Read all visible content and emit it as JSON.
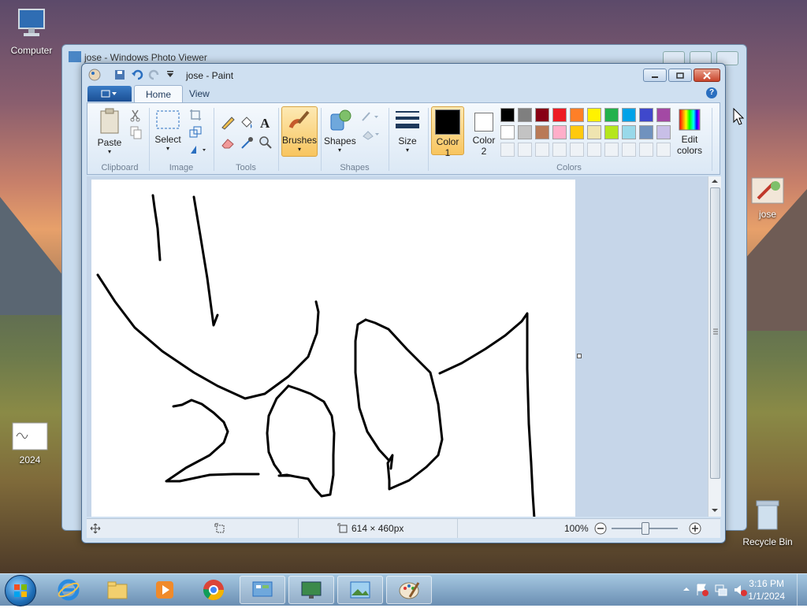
{
  "desktop": {
    "icons": [
      {
        "name": "computer-desktop-icon",
        "label": "Computer"
      },
      {
        "name": "image-2024-desktop-icon",
        "label": "2024"
      },
      {
        "name": "jose-desktop-icon",
        "label": "jose"
      },
      {
        "name": "recycle-bin-desktop-icon",
        "label": "Recycle Bin"
      }
    ]
  },
  "photo_viewer": {
    "title": "jose - Windows Photo Viewer"
  },
  "paint": {
    "title": "jose - Paint",
    "tabs": [
      "Home",
      "View"
    ],
    "groups": {
      "clipboard": "Clipboard",
      "image": "Image",
      "tools": "Tools",
      "shapes": "Shapes",
      "colors": "Colors"
    },
    "buttons": {
      "paste": "Paste",
      "select": "Select",
      "brushes": "Brushes",
      "shapes": "Shapes",
      "size": "Size",
      "color1_a": "Color",
      "color1_b": "1",
      "color2_a": "Color",
      "color2_b": "2",
      "edit_colors_a": "Edit",
      "edit_colors_b": "colors"
    },
    "palette_row1": [
      "#000000",
      "#7f7f7f",
      "#880015",
      "#ed1c24",
      "#ff7f27",
      "#fff200",
      "#22b14c",
      "#00a2e8",
      "#3f48cc",
      "#a349a4"
    ],
    "palette_row2": [
      "#ffffff",
      "#c3c3c3",
      "#b97a57",
      "#ffaec9",
      "#ffc90e",
      "#efe4b0",
      "#b5e61d",
      "#99d9ea",
      "#7092be",
      "#c8bfe7"
    ],
    "color1": "#000000",
    "color2": "#ffffff",
    "status": {
      "dimensions": "614 × 460px",
      "zoom": "100%"
    }
  },
  "taskbar": {
    "clock_time": "3:16 PM",
    "clock_date": "1/1/2024"
  }
}
